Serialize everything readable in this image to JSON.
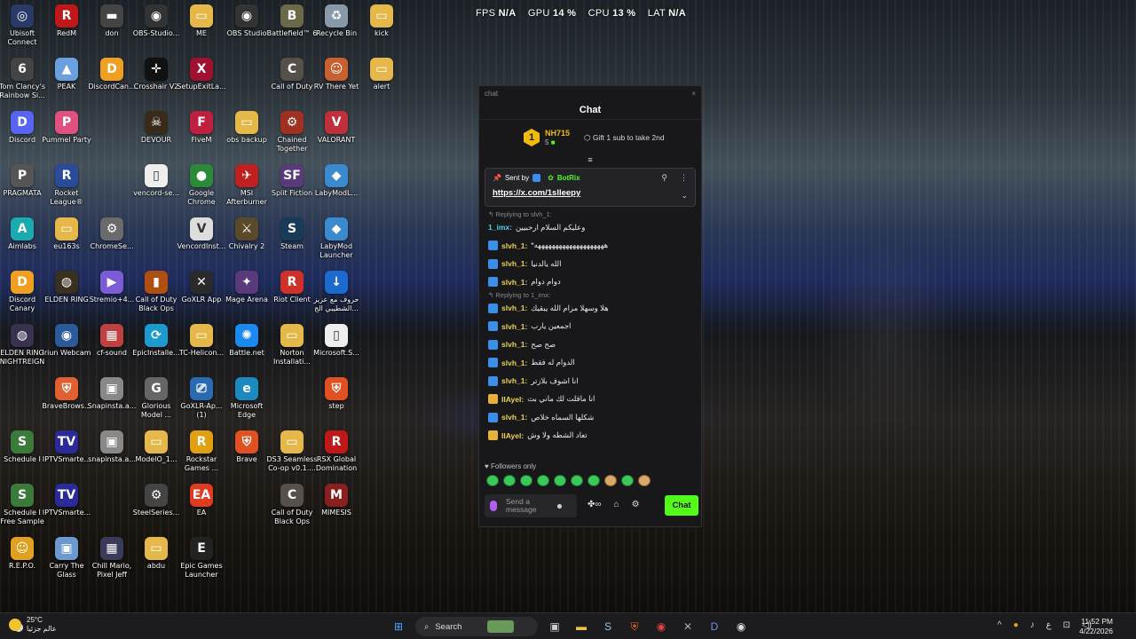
{
  "perf": {
    "fps_label": "FPS",
    "fps": "N/A",
    "gpu_label": "GPU",
    "gpu": "14 %",
    "cpu_label": "CPU",
    "cpu": "13 %",
    "lat_label": "LAT",
    "lat": "N/A"
  },
  "icons": [
    {
      "label": "Ubisoft Connect",
      "color": "#2a3a66",
      "glyph": "◎",
      "icon": "ubisoft-icon"
    },
    {
      "label": "RedM",
      "color": "#c01818",
      "glyph": "R",
      "icon": "redm-icon"
    },
    {
      "label": "don",
      "color": "#444",
      "glyph": "▬",
      "icon": "gun-icon"
    },
    {
      "label": "OBS-Studio...",
      "color": "#333",
      "glyph": "◉",
      "icon": "obs-icon"
    },
    {
      "label": "ME",
      "color": "#e6b84a",
      "glyph": "▭",
      "icon": "folder-icon"
    },
    {
      "label": "OBS Studio",
      "color": "#333",
      "glyph": "◉",
      "icon": "obs-icon"
    },
    {
      "label": "Battlefield™ 6",
      "color": "#6a6a4a",
      "glyph": "B",
      "icon": "battlefield-icon"
    },
    {
      "label": "Recycle Bin",
      "color": "#8899aa",
      "glyph": "♻",
      "icon": "recycle-bin-icon"
    },
    {
      "label": "kick",
      "color": "#e6b84a",
      "glyph": "▭",
      "icon": "folder-icon"
    },
    {
      "label": "Tom Clancy's Rainbow Si...",
      "color": "#444",
      "glyph": "6",
      "icon": "rainbow-six-icon"
    },
    {
      "label": "PEAK",
      "color": "#6aa0e0",
      "glyph": "▲",
      "icon": "peak-icon"
    },
    {
      "label": "DiscordCan...",
      "color": "#f0a020",
      "glyph": "D",
      "icon": "discord-canary-icon"
    },
    {
      "label": "Crosshair V2",
      "color": "#111",
      "glyph": "✛",
      "icon": "crosshair-icon"
    },
    {
      "label": "SetupExitLa...",
      "color": "#a01030",
      "glyph": "X",
      "icon": "setup-icon"
    },
    {
      "label": "Call of Duty",
      "color": "#55504a",
      "glyph": "C",
      "icon": "call-of-duty-icon"
    },
    {
      "label": "RV There Yet",
      "color": "#c86030",
      "glyph": "☺",
      "icon": "rv-there-yet-icon"
    },
    {
      "label": "alert",
      "color": "#e6b84a",
      "glyph": "▭",
      "icon": "folder-icon"
    },
    {
      "label": "Discord",
      "color": "#5865f2",
      "glyph": "D",
      "icon": "discord-icon"
    },
    {
      "label": "Pummel Party",
      "color": "#e05080",
      "glyph": "P",
      "icon": "pummel-party-icon"
    },
    {
      "label": "DEVOUR",
      "color": "#3a2a1a",
      "glyph": "☠",
      "icon": "devour-icon"
    },
    {
      "label": "FiveM",
      "color": "#c02040",
      "glyph": "F",
      "icon": "fivem-icon"
    },
    {
      "label": "obs backup",
      "color": "#e6b84a",
      "glyph": "▭",
      "icon": "folder-icon"
    },
    {
      "label": "Chained Together",
      "color": "#a03020",
      "glyph": "⚙",
      "icon": "chained-together-icon"
    },
    {
      "label": "VALORANT",
      "color": "#c0303a",
      "glyph": "V",
      "icon": "valorant-icon"
    },
    {
      "label": "PRAGMATA",
      "color": "#555",
      "glyph": "P",
      "icon": "pragmata-icon"
    },
    {
      "label": "Rocket League®",
      "color": "#2a4a9a",
      "glyph": "R",
      "icon": "rocket-league-icon"
    },
    {
      "label": "vencord-se...",
      "color": "#eeeeee",
      "glyph": "▯",
      "icon": "file-icon"
    },
    {
      "label": "Google Chrome",
      "color": "#2a8a3a",
      "glyph": "●",
      "icon": "chrome-icon"
    },
    {
      "label": "MSI Afterburner",
      "color": "#c02020",
      "glyph": "✈",
      "icon": "msi-afterburner-icon"
    },
    {
      "label": "Split Fiction",
      "color": "#5a3a7a",
      "glyph": "SF",
      "icon": "split-fiction-icon"
    },
    {
      "label": "LabyModL...",
      "color": "#3a8ad0",
      "glyph": "◆",
      "icon": "labymod-icon"
    },
    {
      "label": "Aimlabs",
      "color": "#1aaab0",
      "glyph": "A",
      "icon": "aimlabs-icon"
    },
    {
      "label": "eu163s",
      "color": "#e6b84a",
      "glyph": "▭",
      "icon": "folder-icon"
    },
    {
      "label": "ChromeSe...",
      "color": "#6a6a6a",
      "glyph": "⚙",
      "icon": "chrome-setup-icon"
    },
    {
      "label": "VencordInst...",
      "color": "#dddddd",
      "glyph": "V",
      "icon": "vencord-installer-icon"
    },
    {
      "label": "Chivalry 2",
      "color": "#5a4a2a",
      "glyph": "⚔",
      "icon": "chivalry-icon"
    },
    {
      "label": "Steam",
      "color": "#1a3a5a",
      "glyph": "S",
      "icon": "steam-icon"
    },
    {
      "label": "LabyMod Launcher",
      "color": "#3a8ad0",
      "glyph": "◆",
      "icon": "labymod-icon"
    },
    {
      "label": "Discord Canary",
      "color": "#f0a020",
      "glyph": "D",
      "icon": "discord-canary-icon"
    },
    {
      "label": "ELDEN RING",
      "color": "#3a3020",
      "glyph": "◍",
      "icon": "elden-ring-icon"
    },
    {
      "label": "Stremio+4...",
      "color": "#7b5bd6",
      "glyph": "▶",
      "icon": "stremio-icon"
    },
    {
      "label": "Call of Duty Black Ops",
      "color": "#b05010",
      "glyph": "▮",
      "icon": "black-ops-icon"
    },
    {
      "label": "GoXLR App",
      "color": "#2a2a2a",
      "glyph": "✕",
      "icon": "goxlr-icon"
    },
    {
      "label": "Mage Arena",
      "color": "#5a3a7a",
      "glyph": "✦",
      "icon": "mage-arena-icon"
    },
    {
      "label": "Riot Client",
      "color": "#d0302a",
      "glyph": "R",
      "icon": "riot-client-icon"
    },
    {
      "label": "حروف مع عزيز الشطيبي الج...",
      "color": "#1a6ad0",
      "glyph": "↓",
      "icon": "download-icon"
    },
    {
      "label": "ELDEN RING NIGHTREIGN",
      "color": "#3a3050",
      "glyph": "◍",
      "icon": "nightreign-icon"
    },
    {
      "label": "Iriun Webcam",
      "color": "#2a5a9a",
      "glyph": "◉",
      "icon": "webcam-icon"
    },
    {
      "label": "cf-sound",
      "color": "#c04040",
      "glyph": "▦",
      "icon": "winrar-icon"
    },
    {
      "label": "EpicInstalle...",
      "color": "#1a9ad0",
      "glyph": "⟳",
      "icon": "epic-installer-icon"
    },
    {
      "label": "TC-Helicon...",
      "color": "#e6b84a",
      "glyph": "▭",
      "icon": "folder-icon"
    },
    {
      "label": "Battle.net",
      "color": "#1a8af0",
      "glyph": "✺",
      "icon": "battlenet-icon"
    },
    {
      "label": "Norton Installati...",
      "color": "#e6b84a",
      "glyph": "▭",
      "icon": "folder-icon"
    },
    {
      "label": "Microsoft.S...",
      "color": "#eeeeee",
      "glyph": "▯",
      "icon": "file-icon"
    },
    {
      "label": "BraveBrows...",
      "color": "#e06030",
      "glyph": "⛨",
      "icon": "brave-installer-icon"
    },
    {
      "label": "Snapinsta.a...",
      "color": "#888",
      "glyph": "▣",
      "icon": "image-file-icon"
    },
    {
      "label": "Glorious Model ...",
      "color": "#666",
      "glyph": "G",
      "icon": "glorious-icon"
    },
    {
      "label": "GoXLR-Ap... (1)",
      "color": "#2a6ab0",
      "glyph": "⎚",
      "icon": "goxlr-installer-icon"
    },
    {
      "label": "Microsoft Edge",
      "color": "#1a8ac0",
      "glyph": "e",
      "icon": "edge-icon"
    },
    {
      "label": "step",
      "color": "#e05020",
      "glyph": "⛨",
      "icon": "brave-icon"
    },
    {
      "label": "Schedule I",
      "color": "#3a7a3a",
      "glyph": "S",
      "icon": "schedule-icon"
    },
    {
      "label": "IPTVSmarte...",
      "color": "#2a2a9a",
      "glyph": "TV",
      "icon": "iptv-icon"
    },
    {
      "label": "snapinsta.a...",
      "color": "#888",
      "glyph": "▣",
      "icon": "image-file-icon"
    },
    {
      "label": "ModelO_1...",
      "color": "#e6b84a",
      "glyph": "▭",
      "icon": "folder-icon"
    },
    {
      "label": "Rockstar Games ...",
      "color": "#e0a010",
      "glyph": "R",
      "icon": "rockstar-icon"
    },
    {
      "label": "Brave",
      "color": "#e05020",
      "glyph": "⛨",
      "icon": "brave-icon"
    },
    {
      "label": "DS3 Seamless Co-op v0.1....",
      "color": "#e6b84a",
      "glyph": "▭",
      "icon": "folder-icon"
    },
    {
      "label": "RSX Global Domination",
      "color": "#c01818",
      "glyph": "R",
      "icon": "rsx-icon"
    },
    {
      "label": "Schedule I Free Sample",
      "color": "#3a7a3a",
      "glyph": "S",
      "icon": "schedule-icon"
    },
    {
      "label": "IPTVSmarte...",
      "color": "#2a2a9a",
      "glyph": "TV",
      "icon": "iptv-icon"
    },
    {
      "label": "SteelSeries...",
      "color": "#444",
      "glyph": "⚙",
      "icon": "steelseries-icon"
    },
    {
      "label": "EA",
      "color": "#e03a20",
      "glyph": "EA",
      "icon": "ea-icon"
    },
    {
      "label": "Call of Duty Black Ops",
      "color": "#55504a",
      "glyph": "C",
      "icon": "call-of-duty-icon"
    },
    {
      "label": "MIMESIS",
      "color": "#882020",
      "glyph": "M",
      "icon": "mimesis-icon"
    },
    {
      "label": "R.E.P.O.",
      "color": "#e0a020",
      "glyph": "☺",
      "icon": "repo-icon"
    },
    {
      "label": "Carry The Glass",
      "color": "#6a9ad0",
      "glyph": "▣",
      "icon": "carry-the-glass-icon"
    },
    {
      "label": "Chill Mario, Pixel Jeff",
      "color": "#3a3a5a",
      "glyph": "▦",
      "icon": "chill-mario-icon"
    },
    {
      "label": "abdu",
      "color": "#e6b84a",
      "glyph": "▭",
      "icon": "folder-icon"
    },
    {
      "label": "Epic Games Launcher",
      "color": "#222",
      "glyph": "E",
      "icon": "epic-games-icon"
    }
  ],
  "chat": {
    "window_title": "chat",
    "close": "×",
    "header": "Chat",
    "gift": {
      "rank": "1",
      "name": "NH715",
      "count": "5",
      "text": "Gift 1 sub to take 2nd"
    },
    "pinned": {
      "sent_by": "Sent by",
      "bot": "BotRix",
      "link": "https://x.com/1slleepy"
    },
    "messages": [
      {
        "reply": "Replying to slvh_1:",
        "user": "1_imx",
        "color": "#4fd0e8",
        "badge": "",
        "text": "وعليكم السلام ارحبيين"
      },
      {
        "reply": "",
        "user": "slvh_1",
        "color": "#e8d44f",
        "badge": "v",
        "text": "*ههههههههههههههههههههه"
      },
      {
        "reply": "",
        "user": "slvh_1",
        "color": "#e8d44f",
        "badge": "v",
        "text": "الله يالدنيا"
      },
      {
        "reply": "",
        "user": "slvh_1",
        "color": "#e8d44f",
        "badge": "v",
        "text": "دوام دوام"
      },
      {
        "reply": "Replying to 1_imx:",
        "user": "slvh_1",
        "color": "#e8d44f",
        "badge": "v",
        "text": "هلا وسهلا مرام الله يبقيك"
      },
      {
        "reply": "",
        "user": "slvh_1",
        "color": "#e8d44f",
        "badge": "v",
        "text": "اجمعين يارب"
      },
      {
        "reply": "",
        "user": "slvh_1",
        "color": "#e8d44f",
        "badge": "v",
        "text": "صح صح"
      },
      {
        "reply": "",
        "user": "slvh_1",
        "color": "#e8d44f",
        "badge": "v",
        "text": "الدوام له فقط"
      },
      {
        "reply": "",
        "user": "slvh_1",
        "color": "#e8d44f",
        "badge": "v",
        "text": "انا اشوف بلازتر"
      },
      {
        "reply": "",
        "user": "IIAyel",
        "color": "#e8d44f",
        "badge": "g",
        "text": "انا ماقلت لك ماني بث"
      },
      {
        "reply": "",
        "user": "slvh_1",
        "color": "#e8d44f",
        "badge": "v",
        "text": "شكلها السماه خلاص"
      },
      {
        "reply": "",
        "user": "IIAyel",
        "color": "#e8d44f",
        "badge": "g",
        "text": "تعاد الشطه ولا وش"
      }
    ],
    "followers_only": "Followers only",
    "input_placeholder": "Send a message",
    "send_label": "Chat"
  },
  "taskbar": {
    "temp": "25°C",
    "weather": "عالم جزئيا",
    "search": "Search",
    "lang": "ع",
    "time": "11:52 PM",
    "date": "4/22/2026"
  }
}
